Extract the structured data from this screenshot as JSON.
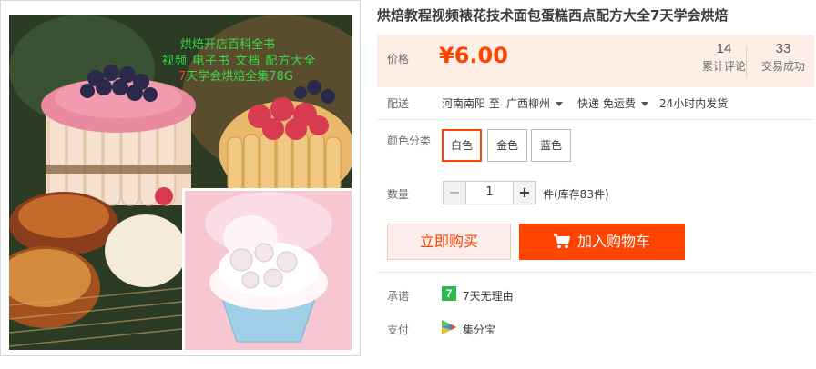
{
  "product": {
    "title": "烘焙教程视频裱花技术面包蛋糕西点配方大全7天学会烘焙",
    "image_overlay": {
      "line1": "烘焙开店百科全书",
      "line2": "视频  电子书  文档    配方大全",
      "line3_num": "7",
      "line3_text": "天学会烘焙全集78G"
    }
  },
  "price": {
    "label": "价格",
    "value": "¥6.00"
  },
  "stats": {
    "reviews_count": "14",
    "reviews_label": "累计评论",
    "sales_count": "33",
    "sales_label": "交易成功"
  },
  "shipping": {
    "label": "配送",
    "from": "河南南阳 至",
    "to": "广西柳州",
    "method": "快递 免运费",
    "dispatch": "24小时内发货"
  },
  "color": {
    "label": "颜色分类",
    "options": [
      "白色",
      "金色",
      "蓝色"
    ],
    "selected": "白色"
  },
  "quantity": {
    "label": "数量",
    "minus": "−",
    "value": "1",
    "plus": "+",
    "stock": "件(库存83件)"
  },
  "actions": {
    "buy_now": "立即购买",
    "add_to_cart": "加入购物车"
  },
  "promise": {
    "label": "承诺",
    "icon_text": "7",
    "text": "7天无理由"
  },
  "payment": {
    "label": "支付",
    "text": "集分宝"
  },
  "colors": {
    "accent": "#ff4400",
    "price_bg": "#fdeee6",
    "promise_green": "#2eb84b"
  }
}
